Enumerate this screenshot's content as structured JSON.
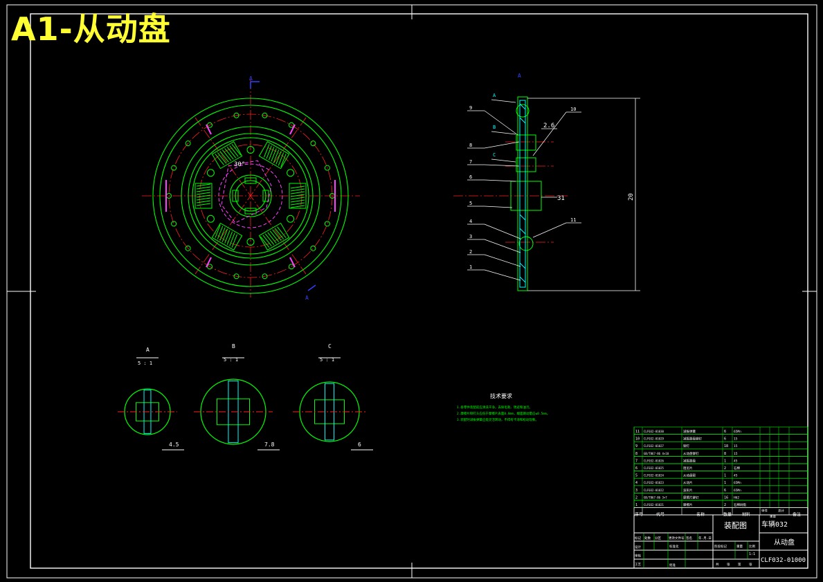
{
  "title": "A1-从动盘",
  "colors": {
    "green": "#00ff00",
    "red": "#ff2020",
    "magenta": "#ff40ff",
    "cyan": "#00ffff",
    "white": "#ffffff",
    "yellow": "#ffff33",
    "blue": "#3040ff"
  },
  "front_view": {
    "angle_label": "30°",
    "section_mark_top": "A",
    "section_mark_bottom": "A"
  },
  "section_view": {
    "top_mark": "A",
    "callouts_left": [
      "A",
      "B",
      "C"
    ],
    "part_numbers_left": [
      "9",
      "8",
      "7",
      "6",
      "5",
      "4",
      "3",
      "2",
      "1"
    ],
    "part_numbers_right": [
      "10",
      "11"
    ],
    "dim_small": "2.6",
    "dim_hub": "31",
    "dim_overall": "20"
  },
  "details": [
    {
      "label": "A",
      "scale": "5 : 1",
      "dim": "4.5"
    },
    {
      "label": "B",
      "scale": "5 : 1",
      "dim": "7.8"
    },
    {
      "label": "C",
      "scale": "5 : 1",
      "dim": "6"
    }
  ],
  "tech_req": {
    "heading": "技术要求",
    "lines": [
      "1.各零件装配前应清洗干净，去除毛刺、锈迹和油污。",
      "2.摩擦片铆钉头应低于摩擦片表面0.8mm，端面跳动量应≤0.5mm。",
      "3.装配时减振弹簧应能灵活转动，不得有卡滞和松动现象。"
    ]
  },
  "bom": {
    "rows": [
      {
        "no": "11",
        "code": "CLF032-01030",
        "name": "减振弹簧",
        "qty": "6",
        "mat": "65Mn"
      },
      {
        "no": "10",
        "code": "CLF032-01029",
        "name": "减振器盘铆钉",
        "qty": "6",
        "mat": "15"
      },
      {
        "no": "9",
        "code": "CLF032-01027",
        "name": "铆钉",
        "qty": "18",
        "mat": "15"
      },
      {
        "no": "8",
        "code": "GB/T867-86 4×10",
        "name": "从动盘铆钉",
        "qty": "8",
        "mat": "15"
      },
      {
        "no": "7",
        "code": "CLF032-01026",
        "name": "减振器盘",
        "qty": "1",
        "mat": "45"
      },
      {
        "no": "6",
        "code": "CLF032-01025",
        "name": "阻尼片",
        "qty": "2",
        "mat": "石棉"
      },
      {
        "no": "5",
        "code": "CLF032-01024",
        "name": "从动盘毂",
        "qty": "1",
        "mat": "45"
      },
      {
        "no": "4",
        "code": "CLF032-01023",
        "name": "从动片",
        "qty": "1",
        "mat": "65Mn"
      },
      {
        "no": "3",
        "code": "CLF032-01022",
        "name": "波形片",
        "qty": "6",
        "mat": "65Mn"
      },
      {
        "no": "2",
        "code": "GB/T867-86 3×7",
        "name": "摩擦片铆钉",
        "qty": "16",
        "mat": "H62"
      },
      {
        "no": "1",
        "code": "CLF032-01021",
        "name": "摩擦片",
        "qty": "2",
        "mat": "石棉树脂"
      }
    ],
    "header": {
      "no": "序号",
      "code": "代号",
      "name": "名称",
      "qty": "数量",
      "mat": "材料",
      "single": "单件",
      "total": "总计",
      "weight": "重量",
      "remark": "备注"
    }
  },
  "title_block": {
    "drawing_type": "装配图",
    "project": "车辆032",
    "part_name": "从动盘",
    "drawing_no": "CLF032-01000",
    "scale": "1:1",
    "rev_labels": [
      "标记",
      "处数",
      "分区",
      "更改文件号",
      "签名",
      "年.月.日"
    ],
    "role_labels": [
      "设计",
      "审核",
      "工艺"
    ],
    "std_label": "标准化",
    "approve_label": "批准",
    "stage_labels": [
      "阶段标记",
      "重量",
      "比例"
    ],
    "sheet_labels": [
      "共",
      "张",
      "第",
      "张"
    ]
  }
}
